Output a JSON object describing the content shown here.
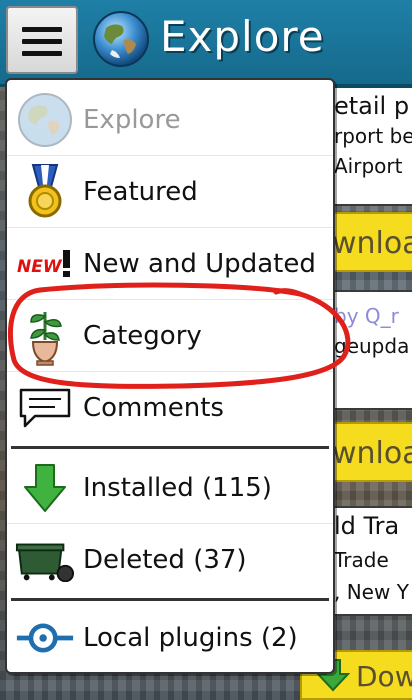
{
  "app": {
    "title": "Explore"
  },
  "background_cards": {
    "card1": {
      "title": "etail p",
      "line2": "rport be",
      "line3": "Airport"
    },
    "download1": "wnloa",
    "card2": {
      "author": "by Q_r",
      "line2": "geupda"
    },
    "download2": "wnloa",
    "card3": {
      "title": "ld Tra",
      "line2": "Trade",
      "line3": ", New Y"
    },
    "download3": "Downloa"
  },
  "menu": {
    "items": [
      {
        "label": "Explore",
        "icon": "globe-icon",
        "disabled": true
      },
      {
        "label": "Featured",
        "icon": "medal-icon",
        "disabled": false
      },
      {
        "label": "New and Updated",
        "icon": "new-badge-icon",
        "disabled": false
      },
      {
        "label": "Category",
        "icon": "potted-plant-icon",
        "disabled": false
      },
      {
        "label": "Comments",
        "icon": "speech-bubble-icon",
        "disabled": false
      },
      {
        "label": "Installed (115)",
        "icon": "download-arrow-icon",
        "disabled": false
      },
      {
        "label": "Deleted (37)",
        "icon": "dumpster-icon",
        "disabled": false
      },
      {
        "label": "Local plugins (2)",
        "icon": "plug-icon",
        "disabled": false
      }
    ]
  },
  "colors": {
    "titlebar": "#1a76a0",
    "download_button": "#f5dc1e",
    "annotation": "#e0201b",
    "install_arrow": "#3aa83a"
  }
}
